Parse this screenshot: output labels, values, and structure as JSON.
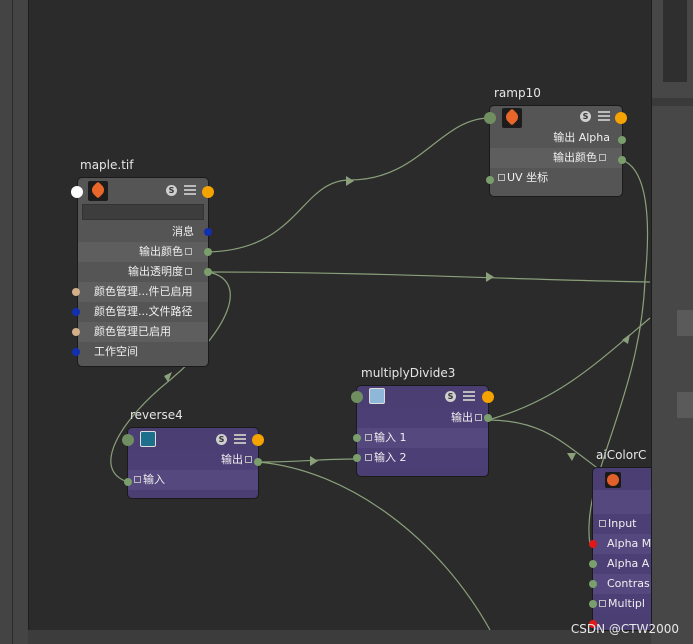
{
  "nodes": {
    "maple": {
      "title": "maple.tif",
      "badge": "S",
      "rows": [
        "消息",
        "输出颜色",
        "输出透明度",
        "颜色管理...件已启用",
        "颜色管理...文件路径",
        "颜色管理已启用",
        "工作空间"
      ],
      "icon": "maple-leaf-icon"
    },
    "ramp": {
      "title": "ramp10",
      "badge": "S",
      "rows": [
        "输出 Alpha",
        "输出颜色",
        "UV 坐标"
      ],
      "icon": "maple-leaf-icon"
    },
    "multiply": {
      "title": "multiplyDivide3",
      "badge": "S",
      "rows": [
        "输出",
        "输入 1",
        "输入 2"
      ],
      "icon": "multiply-divide-icon"
    },
    "reverse": {
      "title": "reverse4",
      "badge": "S",
      "rows": [
        "输出",
        "输入"
      ],
      "icon": "reverse-icon"
    },
    "aicolor": {
      "title": "aiColorC",
      "rows": [
        "Input",
        "Alpha M",
        "Alpha A",
        "Contras",
        "Multipl"
      ],
      "icon": "color-correct-icon"
    }
  },
  "watermark": "CSDN @CTW2000",
  "colors": {
    "editor_bg": "#2b2b2b",
    "wire": "#8aa07a",
    "out_port": "#f5a300",
    "purple_node": "#4a3e72",
    "gray_node": "#555555"
  }
}
